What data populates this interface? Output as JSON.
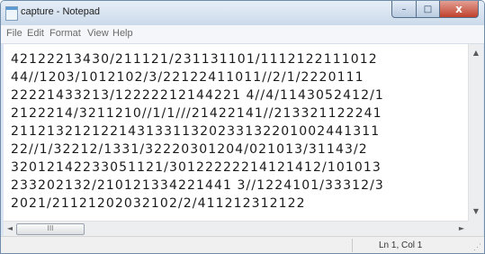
{
  "window": {
    "title": "capture - Notepad",
    "app_icon": "notepad-icon"
  },
  "caption_buttons": {
    "minimize": "–",
    "maximize": "□",
    "close": "x"
  },
  "menu": [
    "File",
    "Edit",
    "Format",
    "View",
    "Help"
  ],
  "editor": {
    "lines": [
      "42122213430/211121/231131101/1112122111012",
      "44//1203/1012102/3/22122411011//2/1/2220111",
      "22221433213/12222212144221 4//4/1143052412/1",
      "2122214/3211210//1/1///21422141//213321122241",
      "21121321212214313311320233132201002441311",
      "22//1/32212/1331/32220301204/021013/31143/2",
      "32012142233051121/30122222214121412/101013",
      "233202132/210121334221441 3//1224101/33312/3",
      "2021/21121202032102/2/411212312122"
    ]
  },
  "scrollbars": {
    "up_arrow": "▲",
    "down_arrow": "▼",
    "left_arrow": "◄",
    "right_arrow": "►",
    "thumb_grip": "III"
  },
  "status": {
    "position": "Ln 1, Col 1",
    "grip": "⋰"
  }
}
